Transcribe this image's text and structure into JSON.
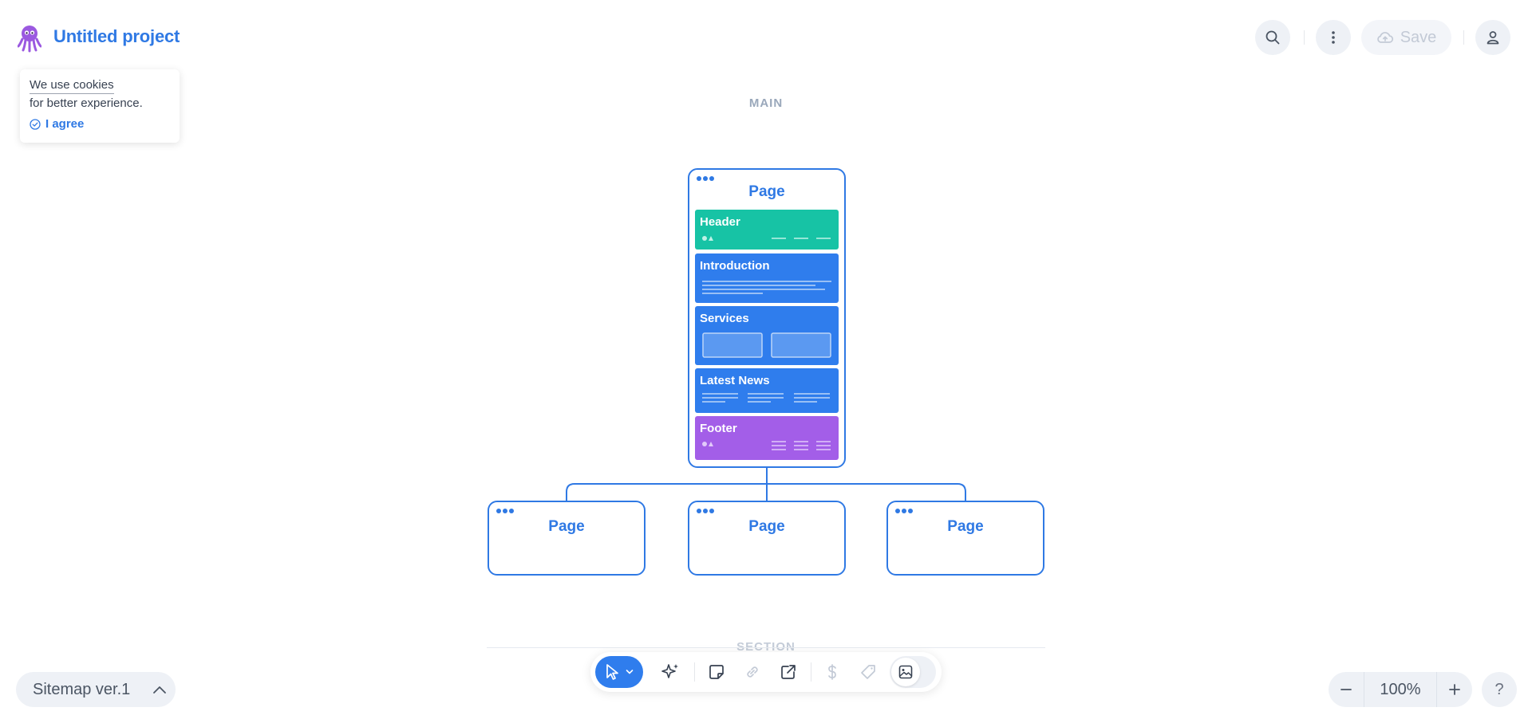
{
  "header": {
    "project_title": "Untitled project",
    "save_label": "Save"
  },
  "cookie": {
    "line1": "We use cookies",
    "line2": "for better experience.",
    "agree_label": "I agree"
  },
  "canvas": {
    "section_top_label": "MAIN",
    "section_bottom_label": "SECTION",
    "main_page": {
      "title": "Page",
      "blocks": [
        {
          "label": "Header"
        },
        {
          "label": "Introduction"
        },
        {
          "label": "Services"
        },
        {
          "label": "Latest News"
        },
        {
          "label": "Footer"
        }
      ]
    },
    "child_pages": [
      {
        "title": "Page"
      },
      {
        "title": "Page"
      },
      {
        "title": "Page"
      }
    ]
  },
  "footer": {
    "sitemap_label": "Sitemap ver.1",
    "zoom_value": "100%",
    "help_label": "?"
  },
  "colors": {
    "accent": "#2f79e4",
    "header_block": "#17c3a5",
    "content_block": "#2f7ded",
    "footer_block": "#a35ee8",
    "logo": "#9b59e0"
  },
  "icons": {
    "logo": "octopus-logo-icon",
    "search": "search-icon",
    "more": "more-vertical-icon",
    "save": "cloud-upload-icon",
    "user": "user-icon",
    "agree": "check-circle-icon",
    "sitemap_toggle": "chevron-up-icon",
    "select_tool": "cursor-icon",
    "ai_tool": "sparkles-icon",
    "note_tool": "sticky-note-icon",
    "link_tool": "link-icon",
    "external_tool": "external-link-icon",
    "dollar_tool": "dollar-icon",
    "tag_tool": "tag-icon",
    "image_toggle": "image-icon",
    "zoom_out": "minus-icon",
    "zoom_in": "plus-icon"
  }
}
